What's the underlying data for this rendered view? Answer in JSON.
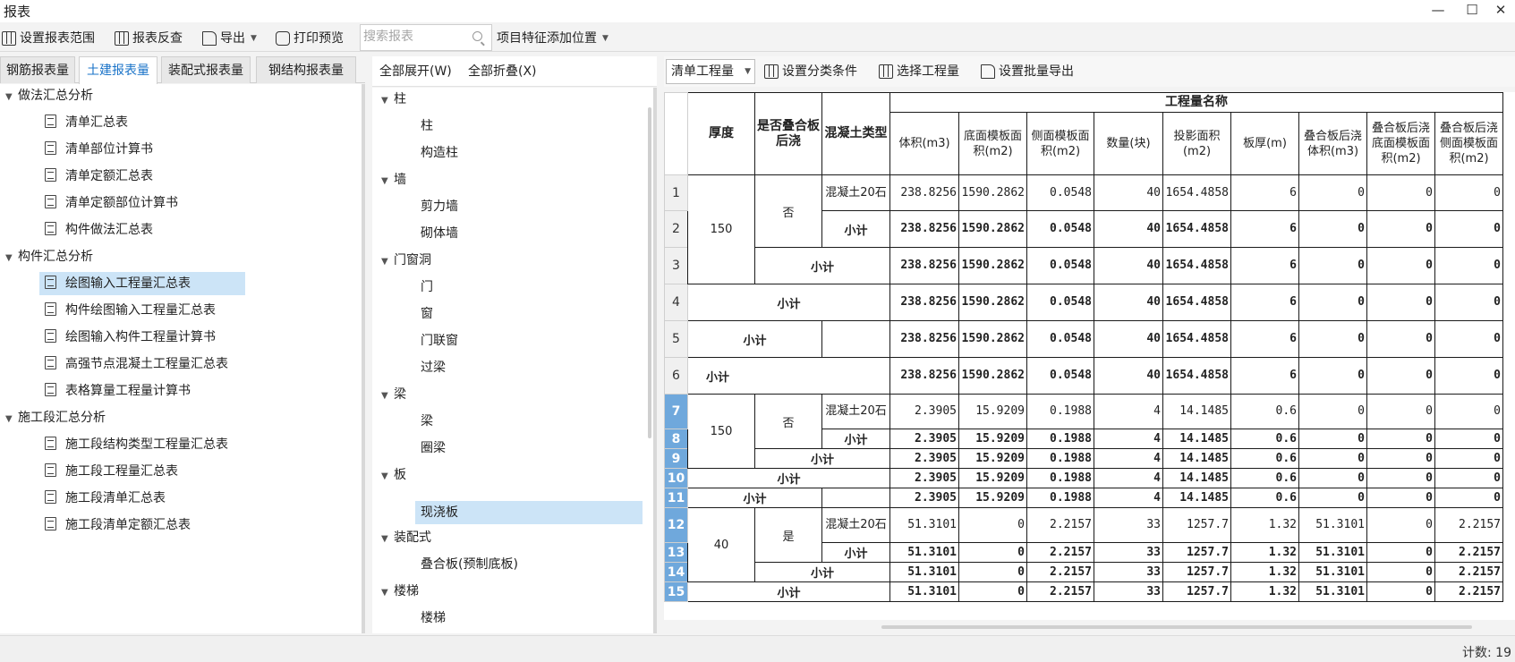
{
  "window": {
    "title": "报表",
    "minimize": "—",
    "maximize": "☐",
    "close": "✕"
  },
  "toolbar": {
    "set_range": "设置报表范围",
    "check": "报表反查",
    "export": "导出",
    "print_preview": "打印预览",
    "search_placeholder": "搜索报表",
    "feature_pos": "项目特征添加位置"
  },
  "left_tabs": [
    "钢筋报表量",
    "土建报表量",
    "装配式报表量",
    "钢结构报表量"
  ],
  "left_tree": {
    "g1": "做法汇总分析",
    "g1_items": [
      "清单汇总表",
      "清单部位计算书",
      "清单定额汇总表",
      "清单定额部位计算书",
      "构件做法汇总表"
    ],
    "g2": "构件汇总分析",
    "g2_items": [
      "绘图输入工程量汇总表",
      "构件绘图输入工程量汇总表",
      "绘图输入构件工程量计算书",
      "高强节点混凝土工程量汇总表",
      "表格算量工程量计算书"
    ],
    "g3": "施工段汇总分析",
    "g3_items": [
      "施工段结构类型工程量汇总表",
      "施工段工程量汇总表",
      "施工段清单汇总表",
      "施工段清单定额汇总表"
    ]
  },
  "mid": {
    "expand_all": "全部展开(W)",
    "collapse_all": "全部折叠(X)",
    "groups": {
      "zhu": "柱",
      "zhu_items": [
        "柱",
        "构造柱"
      ],
      "qiang": "墙",
      "qiang_items": [
        "剪力墙",
        "砌体墙"
      ],
      "mcd": "门窗洞",
      "mcd_items": [
        "门",
        "窗",
        "门联窗",
        "过梁"
      ],
      "liang": "梁",
      "liang_items": [
        "梁",
        "圈梁"
      ],
      "ban": "板",
      "ban_items": [
        "现浇板"
      ],
      "zps": "装配式",
      "zps_items": [
        "叠合板(预制底板)"
      ],
      "lt": "楼梯",
      "lt_items": [
        "楼梯"
      ]
    }
  },
  "right_toolbar": {
    "select_value": "清单工程量",
    "set_category": "设置分类条件",
    "select_qty": "选择工程量",
    "batch_export": "设置批量导出"
  },
  "table": {
    "headers": {
      "thickness": "厚度",
      "post_cast": "是否叠合板后浇",
      "concrete_type": "混凝土类型",
      "group": "工程量名称",
      "cols": [
        "体积(m3)",
        "底面模板面积(m2)",
        "侧面模板面积(m2)",
        "数量(块)",
        "投影面积(m2)",
        "板厚(m)",
        "叠合板后浇体积(m3)",
        "叠合板后浇底面模板面积(m2)",
        "叠合板后浇侧面模板面积(m2)"
      ]
    },
    "subtotal": "小计",
    "blocks": [
      {
        "thickness": "150",
        "post": "否",
        "ctype": "混凝土20石",
        "vals": [
          "238.8256",
          "1590.2862",
          "0.0548",
          "40",
          "1654.4858",
          "6",
          "0",
          "0",
          "0"
        ]
      },
      {
        "thickness": "150",
        "post": "否",
        "ctype": "混凝土20石",
        "vals": [
          "2.3905",
          "15.9209",
          "0.1988",
          "4",
          "14.1485",
          "0.6",
          "0",
          "0",
          "0"
        ]
      },
      {
        "thickness": "40",
        "post": "是",
        "ctype": "混凝土20石",
        "vals": [
          "51.3101",
          "0",
          "2.2157",
          "33",
          "1257.7",
          "1.32",
          "51.3101",
          "0",
          "2.2157"
        ]
      }
    ],
    "row_numbers": [
      "1",
      "2",
      "3",
      "4",
      "5",
      "6",
      "7",
      "8",
      "9",
      "10",
      "11",
      "12",
      "13",
      "14",
      "15"
    ]
  },
  "status": {
    "count": "计数: 19"
  },
  "colors": {
    "accent": "#1a73c8",
    "selected_bg": "#cce4f7",
    "rownum_blue": "#6fa8dc"
  }
}
